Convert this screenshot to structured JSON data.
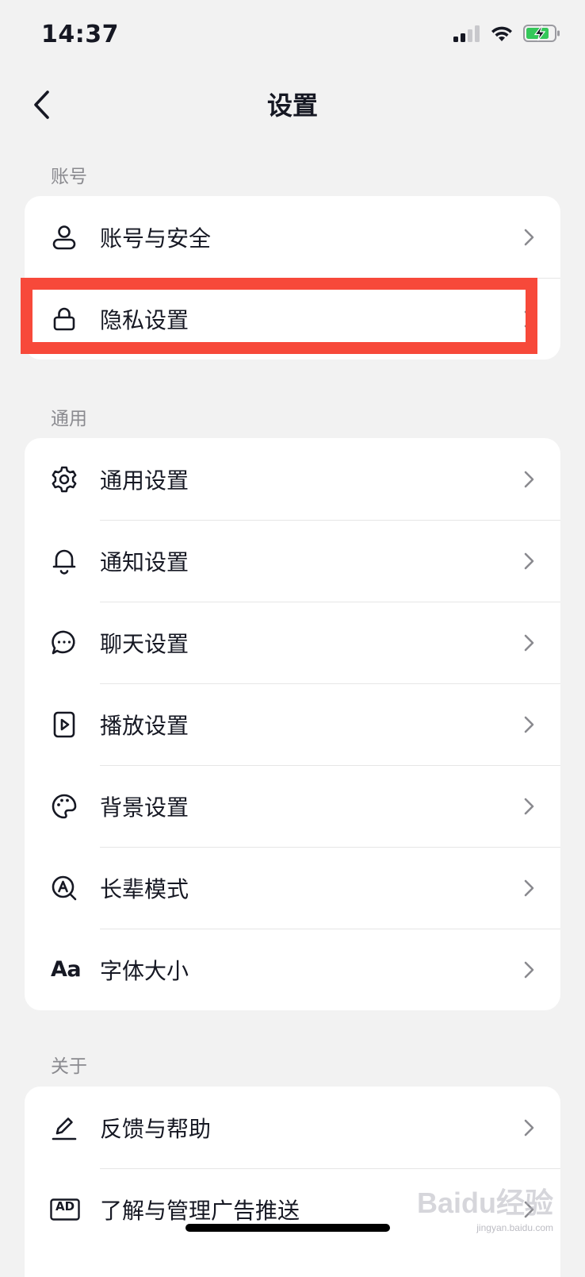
{
  "status_bar": {
    "time": "14:37"
  },
  "nav": {
    "title": "设置"
  },
  "sections": [
    {
      "label": "账号",
      "items": [
        {
          "label": "账号与安全",
          "icon": "person-icon"
        },
        {
          "label": "隐私设置",
          "icon": "lock-icon"
        }
      ]
    },
    {
      "label": "通用",
      "items": [
        {
          "label": "通用设置",
          "icon": "gear-icon"
        },
        {
          "label": "通知设置",
          "icon": "bell-icon"
        },
        {
          "label": "聊天设置",
          "icon": "chat-bubble-icon"
        },
        {
          "label": "播放设置",
          "icon": "play-icon"
        },
        {
          "label": "背景设置",
          "icon": "palette-icon"
        },
        {
          "label": "长辈模式",
          "icon": "elder-mode-icon"
        },
        {
          "label": "字体大小",
          "icon": "font-size-icon",
          "icon_text": "Aa"
        }
      ]
    },
    {
      "label": "关于",
      "items": [
        {
          "label": "反馈与帮助",
          "icon": "pencil-icon"
        },
        {
          "label": "了解与管理广告推送",
          "icon": "ad-icon",
          "icon_text": "AD"
        }
      ]
    }
  ],
  "watermark": {
    "text": "Baidu经验",
    "sub": "jingyan.baidu.com"
  },
  "colors": {
    "background": "#f2f2f2",
    "card": "#ffffff",
    "highlight": "#f7493a",
    "text": "#161823",
    "section_label": "#8a8a8f",
    "chevron": "#8a8a8f"
  }
}
